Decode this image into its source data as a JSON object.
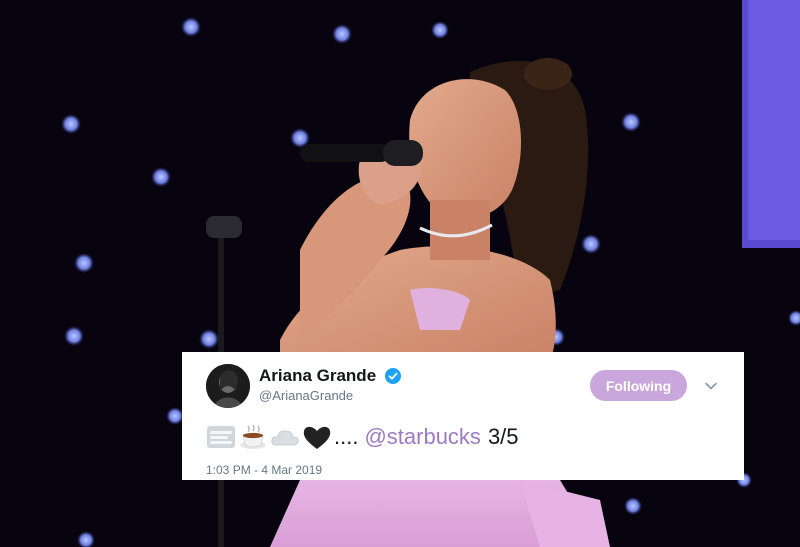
{
  "tweet": {
    "display_name": "Ariana Grande",
    "handle": "@ArianaGrande",
    "follow_label": "Following",
    "text_dots": "....",
    "mention": "@starbucks",
    "count_text": "3/5",
    "timestamp": "1:03 PM - 4 Mar 2019",
    "emojis": [
      "fog-icon",
      "coffee-icon",
      "cloud-icon",
      "black-heart-icon"
    ]
  },
  "colors": {
    "background": "#07040f",
    "follow_button": "#c9a7dc",
    "mention": "#9e79c4",
    "verified": "#1da1f2",
    "dress": "#e6b3e4"
  }
}
